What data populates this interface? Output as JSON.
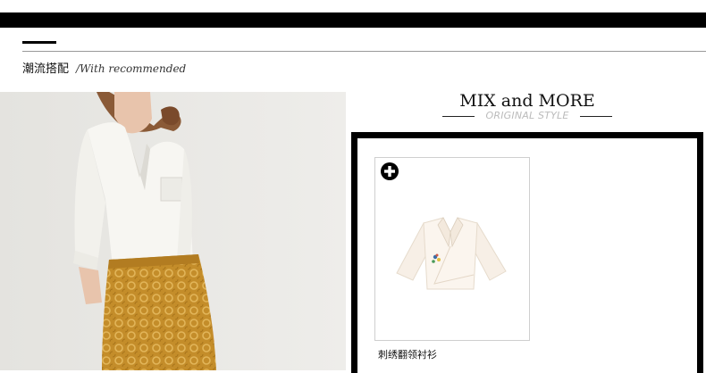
{
  "section": {
    "title_cn": "潮流搭配",
    "title_en": "/With recommended"
  },
  "mix": {
    "title": "MIX and MORE",
    "subtitle": "ORIGINAL STYLE"
  },
  "product": {
    "name": "刺绣翻领衬衫",
    "add_icon": "plus-circle-icon"
  },
  "colors": {
    "bar": "#000000",
    "subtitle": "#bbbbbb",
    "skirt": "#c9952f",
    "photo_bg": "#e9e8e4"
  }
}
